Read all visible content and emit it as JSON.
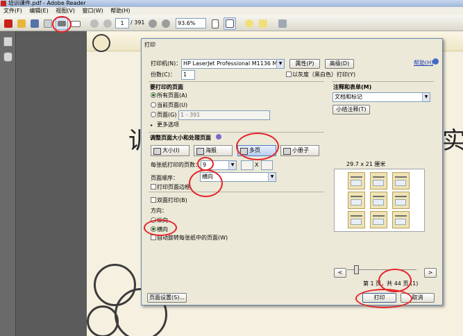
{
  "window": {
    "title": "培训课件.pdf - Adobe Reader"
  },
  "menu": [
    "文件(F)",
    "编辑(E)",
    "视图(V)",
    "窗口(W)",
    "帮助(H)"
  ],
  "toolbar": {
    "page_current": "1",
    "page_total": "/ 391",
    "zoom": "93.6%"
  },
  "document": {
    "left_char": "训",
    "right_char": "实"
  },
  "dialog": {
    "title": "打印",
    "printer_label": "打印机(N)：",
    "printer_value": "HP LaserJet Professional M1136 MFP",
    "properties_btn": "属性(P)",
    "advanced_btn": "高级(D)",
    "help_link": "帮助(H)",
    "copies_label": "份数(C)：",
    "copies_value": "1",
    "grayscale_label": "以灰度（黑白色）打印(Y)",
    "pages_group": "要打印的页面",
    "radio_all": "所有页面(A)",
    "radio_current": "当前页面(U)",
    "radio_pages": "页面(G)",
    "pages_range": "1 - 391",
    "more_options": "更多选项",
    "comments_group": "注释和表单(M)",
    "comments_value": "文档和标记",
    "summarize_btn": "小结注释(T)",
    "size_group": "调整页面大小和处理页面",
    "size_btns": [
      "大小(I)",
      "海报",
      "多页",
      "小册子"
    ],
    "pages_per_sheet_label": "每张纸打印的页数：",
    "pages_per_sheet_value": "9",
    "x_sep": "X",
    "page_order_label": "页面顺序：",
    "page_order_value": "横向",
    "print_border": "打印页面边框",
    "duplex": "双面打印(B)",
    "orientation_label": "方向：",
    "portrait": "纵向",
    "landscape": "横向",
    "auto_rotate": "自动旋转每张纸中的页面(W)",
    "preview_size": "29.7 x 21 厘米",
    "nav_prev": "<",
    "nav_next": ">",
    "page_count": "第 1 页，共 44 页 (1)",
    "page_setup_btn": "页面设置(S)...",
    "print_btn": "打印",
    "cancel_btn": "取消"
  }
}
